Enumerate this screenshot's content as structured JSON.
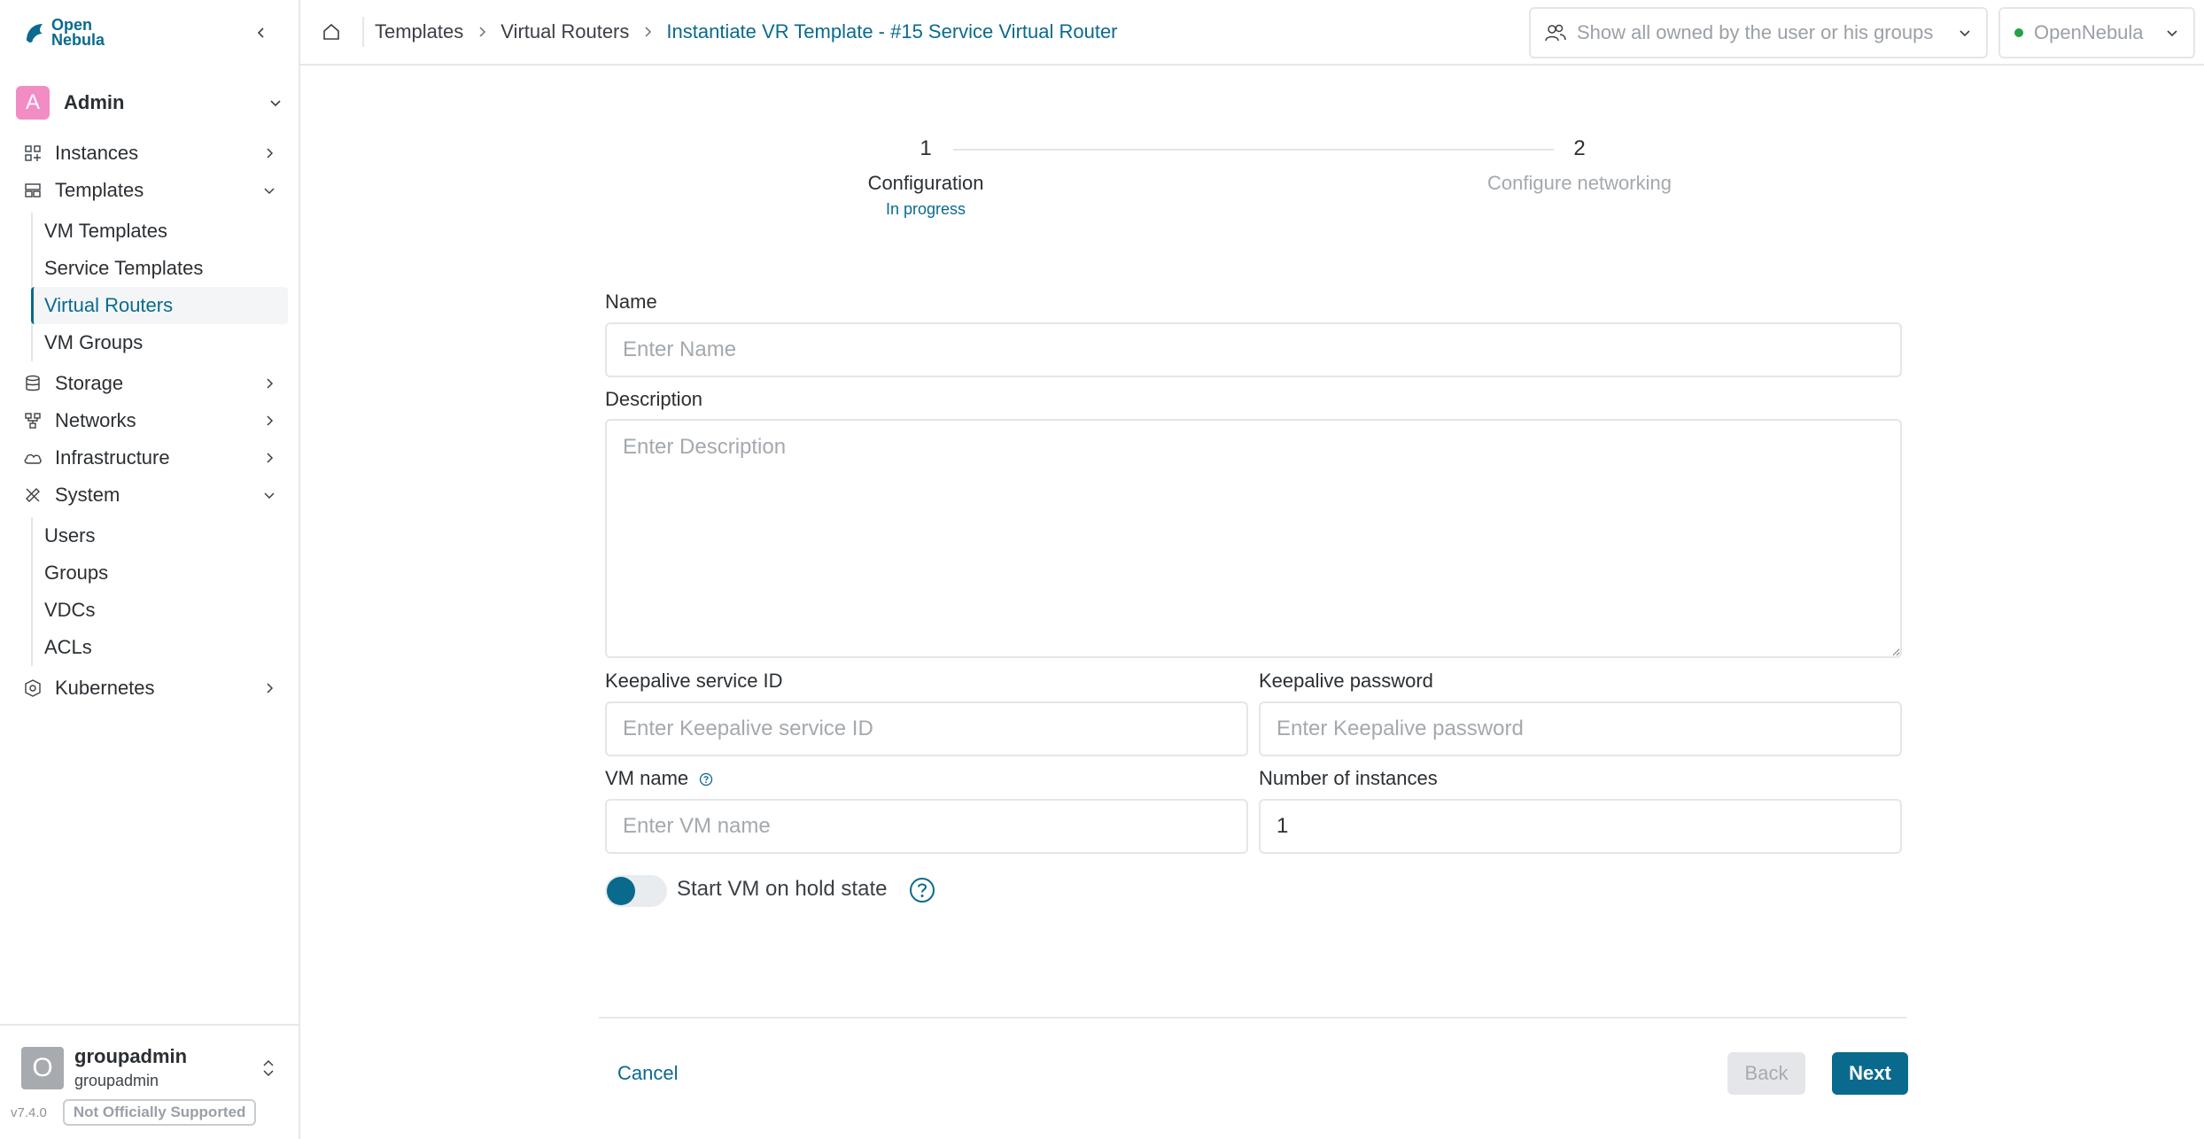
{
  "app": {
    "logo_text_line1": "Open",
    "logo_text_line2": "Nebula"
  },
  "account": {
    "initial": "A",
    "name": "Admin"
  },
  "sidebar": {
    "items": [
      {
        "label": "Instances",
        "icon": "grid-icon",
        "expanded": false
      },
      {
        "label": "Templates",
        "icon": "template-icon",
        "expanded": true,
        "children": [
          "VM Templates",
          "Service Templates",
          "Virtual Routers",
          "VM Groups"
        ]
      },
      {
        "label": "Storage",
        "icon": "database-icon",
        "expanded": false
      },
      {
        "label": "Networks",
        "icon": "network-icon",
        "expanded": false
      },
      {
        "label": "Infrastructure",
        "icon": "cloud-icon",
        "expanded": false
      },
      {
        "label": "System",
        "icon": "tools-icon",
        "expanded": true,
        "children": [
          "Users",
          "Groups",
          "VDCs",
          "ACLs"
        ]
      },
      {
        "label": "Kubernetes",
        "icon": "kubernetes-icon",
        "expanded": false
      }
    ],
    "active_child": "Virtual Routers"
  },
  "user": {
    "initial": "O",
    "name": "groupadmin",
    "group": "groupadmin",
    "version": "v7.4.0",
    "support_badge": "Not Officially Supported"
  },
  "header": {
    "breadcrumb": [
      "Templates",
      "Virtual Routers",
      "Instantiate VR Template - #15 Service Virtual Router"
    ],
    "filter_placeholder": "Show all owned by the user or his groups",
    "zone": "OpenNebula",
    "zone_status_color": "#23a247"
  },
  "stepper": {
    "steps": [
      {
        "number": "1",
        "label": "Configuration",
        "status": "In progress"
      },
      {
        "number": "2",
        "label": "Configure networking",
        "status": ""
      }
    ]
  },
  "form": {
    "name_label": "Name",
    "name_placeholder": "Enter Name",
    "description_label": "Description",
    "description_placeholder": "Enter Description",
    "keepalive_id_label": "Keepalive service ID",
    "keepalive_id_placeholder": "Enter Keepalive service ID",
    "keepalive_password_label": "Keepalive password",
    "keepalive_password_placeholder": "Enter Keepalive password",
    "vm_name_label": "VM name",
    "vm_name_placeholder": "Enter VM name",
    "instances_label": "Number of instances",
    "instances_value": "1",
    "hold_label": "Start VM on hold state",
    "hold_enabled": false
  },
  "actions": {
    "cancel": "Cancel",
    "back": "Back",
    "next": "Next"
  },
  "colors": {
    "accent": "#0a6a8e",
    "avatar_admin": "#f28cc4",
    "avatar_user": "#a7aaae"
  }
}
